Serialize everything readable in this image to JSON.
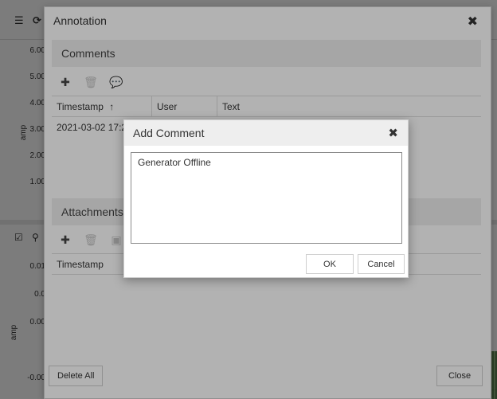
{
  "background": {
    "upper_chart": {
      "y_axis_label": "amp",
      "y_ticks": [
        "6.00",
        "5.00",
        "4.00",
        "3.00",
        "2.00",
        "1.00"
      ]
    },
    "lower_chart": {
      "y_axis_label": "amp",
      "y_ticks": [
        "0.01",
        "0.0",
        "0.00",
        "-0.00"
      ]
    }
  },
  "annotation": {
    "title": "Annotation",
    "comments": {
      "title": "Comments",
      "columns": [
        "Timestamp",
        "User",
        "Text"
      ],
      "sort_indicator": "↑",
      "rows": [
        {
          "timestamp": "2021-03-02 17:27",
          "user": "",
          "text": ""
        }
      ]
    },
    "attachments": {
      "title": "Attachments",
      "columns": [
        "Timestamp"
      ]
    },
    "delete_all_label": "Delete All",
    "close_label": "Close"
  },
  "add_comment": {
    "title": "Add Comment",
    "text_value": "Generator Offline",
    "ok_label": "OK",
    "cancel_label": "Cancel"
  },
  "icons": {
    "add": "plus-icon",
    "delete": "trash-icon",
    "comments": "comments-icon",
    "image": "image-icon",
    "close": "close-icon",
    "menu": "menu-icon",
    "refresh": "refresh-icon",
    "check": "checkbox-icon",
    "zoom": "zoom-icon"
  }
}
